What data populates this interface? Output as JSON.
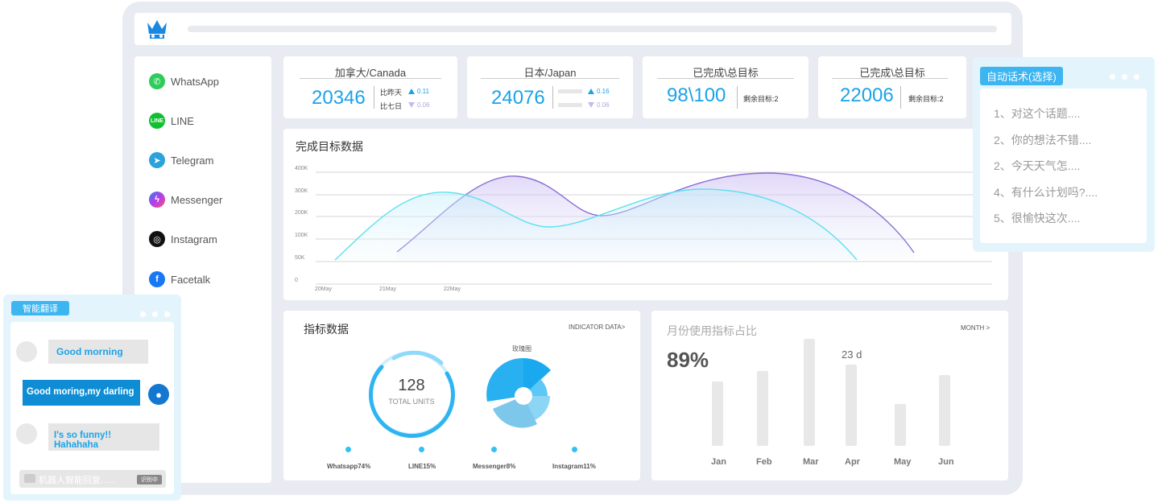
{
  "sidebar": {
    "items": [
      {
        "label": "WhatsApp",
        "icon": "whatsapp-icon"
      },
      {
        "label": "LINE",
        "icon": "line-icon"
      },
      {
        "label": "Telegram",
        "icon": "telegram-icon"
      },
      {
        "label": "Messenger",
        "icon": "messenger-icon"
      },
      {
        "label": "Instagram",
        "icon": "instagram-icon"
      },
      {
        "label": "Facetalk",
        "icon": "facebook-icon"
      }
    ]
  },
  "stats": {
    "canada": {
      "title": "加拿大/Canada",
      "value": "20346",
      "vs_yesterday": "比昨天",
      "vs_week": "比七日",
      "up": "0.11",
      "down": "0.06"
    },
    "japan": {
      "title": "日本/Japan",
      "value": "24076",
      "up": "0.16",
      "down": "0.06"
    },
    "done1": {
      "title": "已完成\\总目标",
      "value": "98\\100",
      "remain": "剩余目标:2"
    },
    "done2": {
      "title": "已完成\\总目标",
      "value": "22006",
      "remain": "剩余目标:2"
    }
  },
  "line_chart": {
    "title": "完成目标数据",
    "y_ticks": [
      "400K",
      "300K",
      "200K",
      "100K",
      "50K",
      "0"
    ],
    "x_ticks": [
      "20May",
      "21May",
      "22May"
    ]
  },
  "indicator": {
    "title": "指标数据",
    "link": "INDICATOR DATA>",
    "total_value": "128",
    "total_label": "TOTAL UNITS",
    "rose_label": "玫瑰图",
    "legend": [
      "Whatsapp74%",
      "LINE15%",
      "Messenger8%",
      "Instagram11%"
    ]
  },
  "monthly": {
    "title": "月份使用指标占比",
    "link": "MONTH >",
    "percent": "89%",
    "days": "23 d",
    "months": [
      "Jan",
      "Feb",
      "Mar",
      "Apr",
      "May",
      "Jun"
    ]
  },
  "auto_script": {
    "tag": "自动话术(选择)",
    "lines": [
      "1、对这个话题....",
      "2、你的想法不错....",
      "2、今天天气怎....",
      "4、有什么计划吗?....",
      "5、很愉快这次...."
    ]
  },
  "translate": {
    "tag": "智能翻译",
    "msg1": "Good morning",
    "msg2": "Good moring,my darling",
    "msg3": "I's so funny!! Hahahaha",
    "robot": "机器人智能回复......",
    "robot_badge": "识别中"
  },
  "chart_data": [
    {
      "type": "line",
      "title": "完成目标数据",
      "x": [
        "20May",
        "21May",
        "22May"
      ],
      "ylim": [
        0,
        400000
      ],
      "y_ticks": [
        "0",
        "50K",
        "100K",
        "200K",
        "300K",
        "400K"
      ],
      "series": [
        {
          "color": "#5ee0f0",
          "values": [
            50000,
            270000,
            160000,
            300000,
            50000
          ]
        },
        {
          "color": "#8a6fd6",
          "values": [
            50000,
            350000,
            200000,
            360000,
            60000
          ]
        }
      ]
    },
    {
      "type": "bar",
      "title": "月份使用指标占比",
      "categories": [
        "Jan",
        "Feb",
        "Mar",
        "Apr",
        "May",
        "Jun"
      ],
      "values": [
        60,
        70,
        100,
        76,
        39,
        66
      ]
    }
  ],
  "colors": {
    "accent": "#1aa3e8",
    "purple": "#8a6fd6",
    "cyan": "#5ee0f0"
  }
}
